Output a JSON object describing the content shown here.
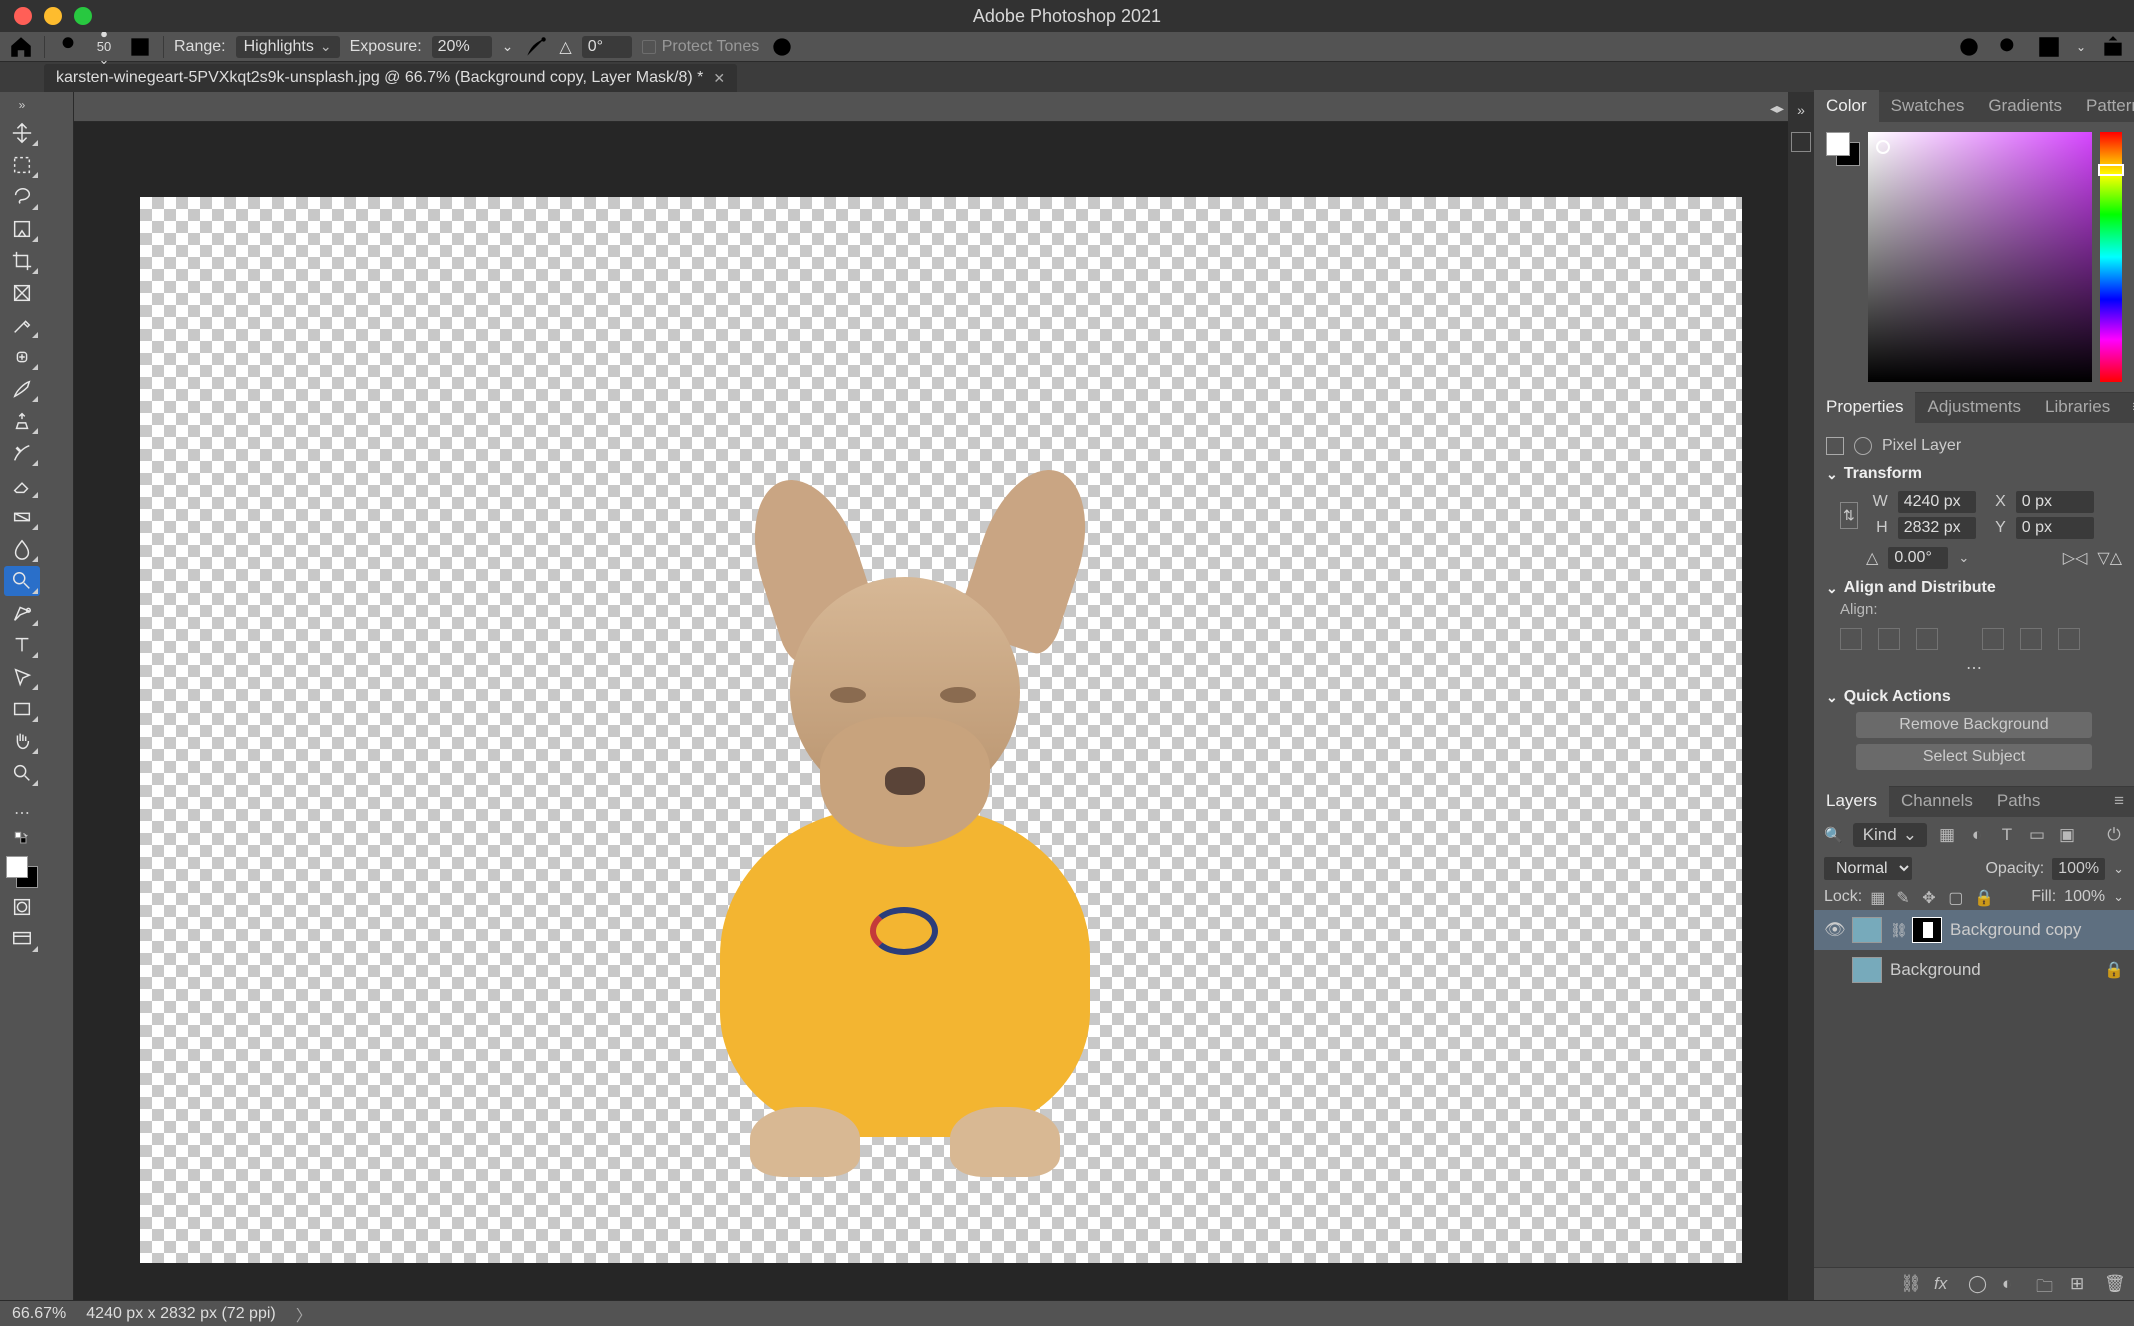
{
  "app": {
    "title": "Adobe Photoshop 2021"
  },
  "optionsbar": {
    "brush_size": "50",
    "range_label": "Range:",
    "range_value": "Highlights",
    "exposure_label": "Exposure:",
    "exposure_value": "20%",
    "angle_label": "0°",
    "protect_tones": "Protect Tones"
  },
  "file_tab": {
    "name": "karsten-winegeart-5PVXkqt2s9k-unsplash.jpg @ 66.7% (Background copy, Layer Mask/8) *"
  },
  "status": {
    "zoom": "66.67%",
    "doc_info": "4240 px x 2832 px (72 ppi)"
  },
  "panels": {
    "color_tabs": [
      "Color",
      "Swatches",
      "Gradients",
      "Patterns"
    ],
    "color_active": "Color",
    "properties_tabs": [
      "Properties",
      "Adjustments",
      "Libraries"
    ],
    "properties_active": "Properties",
    "layers_tabs": [
      "Layers",
      "Channels",
      "Paths"
    ],
    "layers_active": "Layers",
    "properties": {
      "type_label": "Pixel Layer",
      "transform_label": "Transform",
      "W_label": "W",
      "W": "4240 px",
      "H_label": "H",
      "H": "2832 px",
      "X_label": "X",
      "X": "0 px",
      "Y_label": "Y",
      "Y": "0 px",
      "angle": "0.00°",
      "align_label": "Align and Distribute",
      "align_sub": "Align:",
      "quick_actions": "Quick Actions",
      "remove_bg": "Remove Background",
      "select_subject": "Select Subject"
    },
    "layers": {
      "filter_kind": "Kind",
      "blend_mode": "Normal",
      "opacity_label": "Opacity:",
      "opacity": "100%",
      "fill_label": "Fill:",
      "fill": "100%",
      "lock_label": "Lock:",
      "items": [
        {
          "name": "Background copy",
          "visible": true,
          "has_mask": true,
          "locked": false,
          "selected": true
        },
        {
          "name": "Background",
          "visible": false,
          "has_mask": false,
          "locked": true,
          "selected": false
        }
      ]
    }
  },
  "tools": [
    "move",
    "artboard",
    "lasso",
    "magic-wand",
    "crop",
    "frame",
    "eyedropper",
    "healing",
    "brush",
    "clone",
    "history-brush",
    "eraser",
    "gradient",
    "blur",
    "dodge",
    "pen",
    "type",
    "path-select",
    "rectangle",
    "hand",
    "zoom"
  ]
}
